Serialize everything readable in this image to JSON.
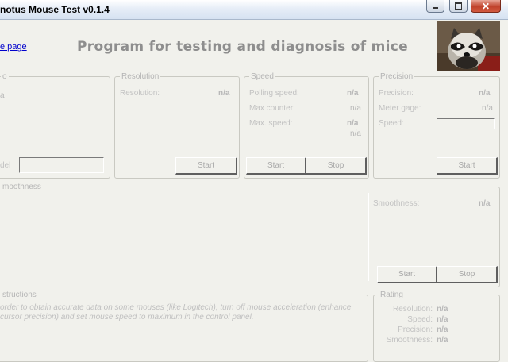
{
  "window": {
    "title": "notus Mouse Test v0.1.4",
    "controls": {
      "minimize": "minimize",
      "maximize": "maximize",
      "close": "close"
    }
  },
  "header": {
    "homepage_link": "e page",
    "headline": "Program for testing and diagnosis of mice"
  },
  "panels": {
    "left": {
      "legend": "o",
      "value": "a",
      "field_label": "del"
    },
    "resolution": {
      "legend": "Resolution",
      "resolution_label": "Resolution:",
      "resolution_value": "n/a",
      "start_button": "Start"
    },
    "speed": {
      "legend": "Speed",
      "polling_label": "Polling speed:",
      "polling_value": "n/a",
      "max_counter_label": "Max counter:",
      "max_counter_value": "n/a",
      "max_speed_label": "Max. speed:",
      "max_speed_value": "n/a",
      "max_speed_value2": "n/a",
      "start_button": "Start",
      "stop_button": "Stop"
    },
    "precision": {
      "legend": "Precision",
      "precision_label": "Precision:",
      "precision_value": "n/a",
      "meter_label": "Meter gage:",
      "meter_value": "n/a",
      "speed_label": "Speed:",
      "start_button": "Start"
    },
    "smoothness": {
      "legend": "moothness",
      "smoothness_label": "Smoothness:",
      "smoothness_value": "n/a",
      "start_button": "Start",
      "stop_button": "Stop"
    },
    "instructions": {
      "legend": "structions",
      "text": "order to obtain accurate data on some mouses (like Logitech), turn off mouse acceleration (enhance cursor precision) and set mouse speed to maximum in the control panel."
    },
    "rating": {
      "legend": "Rating",
      "rows": [
        {
          "label": "Resolution:",
          "value": "n/a"
        },
        {
          "label": "Speed:",
          "value": "n/a"
        },
        {
          "label": "Precision:",
          "value": "n/a"
        },
        {
          "label": "Smoothness:",
          "value": "n/a"
        }
      ]
    }
  },
  "icons": {
    "logo": "raccoon-logo",
    "minimize": "minimize-icon",
    "maximize": "maximize-icon",
    "close": "close-icon"
  }
}
